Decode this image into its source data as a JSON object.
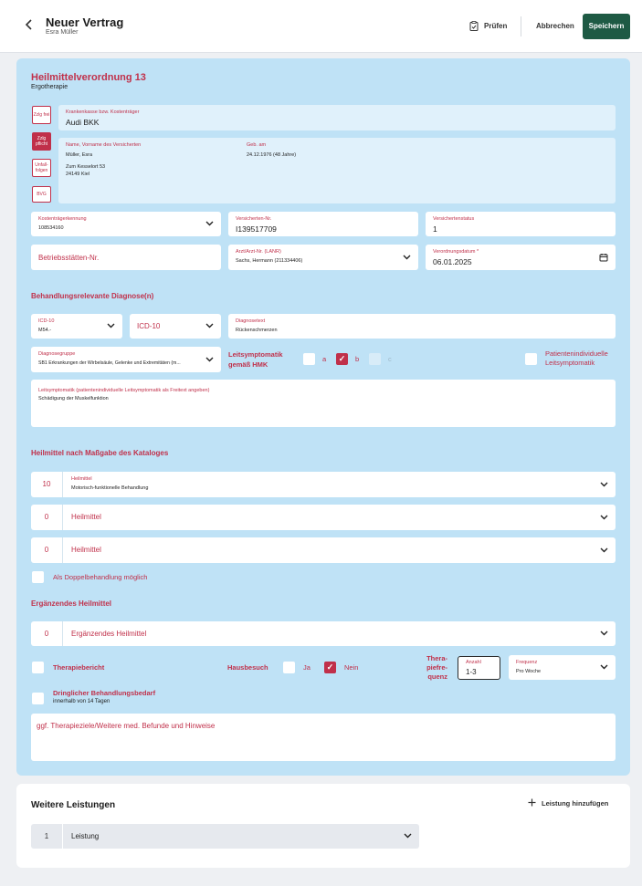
{
  "header": {
    "title": "Neuer Vertrag",
    "subtitle": "Esra Müller",
    "check_label": "Prüfen",
    "cancel_label": "Abbrechen",
    "save_label": "Speichern"
  },
  "prescription": {
    "heading": "Heilmittelverordnung 13",
    "subheading": "Ergotherapie",
    "tags": [
      "Zzlg frei",
      "Zzlg pflicht",
      "Unfall-folgen",
      "BVG"
    ],
    "insurer_label": "Krankenkasse bzw. Kostenträger",
    "insurer_value": "Audi BKK",
    "patient_name_label": "Name, Vorname des Versicherten",
    "patient_name": "Müller, Esra",
    "patient_street": "Zum Kesselort 53",
    "patient_city": "24149 Kiel",
    "birth_label": "Geb. am",
    "birth_value": "24.12.1976 (48 Jahre)",
    "kostentraeger_label": "Kostenträgerkennung",
    "kostentraeger_value": "108534160",
    "versicherten_label": "Versicherten-Nr.",
    "versicherten_value": "I139517709",
    "status_label": "Versichertenstatus",
    "status_value": "1",
    "betrieb_placeholder": "Betriebsstätten-Nr.",
    "arzt_label": "Arzt/Arzt-Nr. (LANR)",
    "arzt_value": "Sachs, Hermann (211334406)",
    "datum_label": "Verordnungsdatum *",
    "datum_value": "06.01.2025"
  },
  "diagnosis": {
    "section": "Behandlungsrelevante Diagnose(n)",
    "icd1_label": "ICD-10",
    "icd1_value": "M54.-",
    "icd2_placeholder": "ICD-10",
    "text_label": "Diagnosetext",
    "text_value": "Rückenschmerzen",
    "group_label": "Diagnosegruppe",
    "group_value": "SB1 Erkrankungen der Wirbelsäule, Gelenke und Extremitäten (m...",
    "leit_label": "Leitsymptomatik gemäß HMK",
    "opt_a": "a",
    "opt_b": "b",
    "opt_c": "c",
    "individual_label": "Patientenindividuelle Leitsymptomatik",
    "leit_text_label": "Leitsymptomatik (patientenindividuelle Leitsymptomatik als Freitext angeben)",
    "leit_text_value": "Schädigung der Muskelfunktion"
  },
  "remedies": {
    "section": "Heilmittel nach Maßgabe des Kataloges",
    "rows": [
      {
        "count": "10",
        "label": "Heilmittel",
        "value": "Motorisch-funktionelle Behandlung"
      },
      {
        "count": "0",
        "label": "Heilmittel",
        "value": ""
      },
      {
        "count": "0",
        "label": "Heilmittel",
        "value": ""
      }
    ],
    "double_label": "Als Doppelbehandlung möglich"
  },
  "supplementary": {
    "section": "Ergänzendes Heilmittel",
    "count": "0",
    "placeholder": "Ergänzendes Heilmittel",
    "report_label": "Therapiebericht",
    "visit_label": "Hausbesuch",
    "yes_label": "Ja",
    "no_label": "Nein",
    "freq_label": "Thera-piefre-quenz",
    "anzahl_label": "Anzahl",
    "anzahl_value": "1-3",
    "frequenz_label": "Frequenz",
    "frequenz_value": "Pro Woche",
    "urgent_label": "Dringlicher Behandlungsbedarf",
    "urgent_sub": "innerhalb von 14 Tagen",
    "goals_placeholder": "ggf. Therapieziele/Weitere med. Befunde und Hinweise"
  },
  "more": {
    "section": "Weitere Leistungen",
    "add_label": "Leistung hinzufügen",
    "row_count": "1",
    "row_placeholder": "Leistung"
  },
  "colors": {
    "accent": "#c0304a",
    "save_button": "#1e5a44",
    "card_bg": "#bfe2f6"
  }
}
